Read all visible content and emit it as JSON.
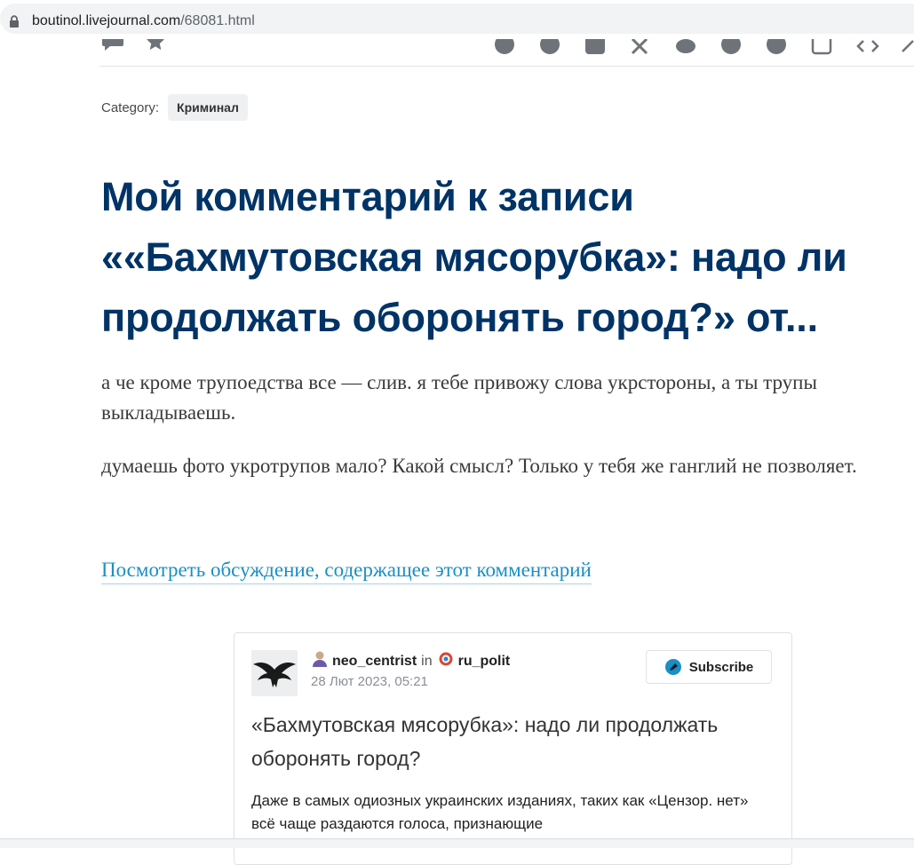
{
  "browser": {
    "url_host": "boutinol.livejournal.com",
    "url_path": "/68081.html"
  },
  "toolbar": {
    "left_icons": [
      "comment-icon",
      "bookmark-icon"
    ],
    "share_icons": [
      "vk-icon",
      "facebook-icon",
      "ok-icon",
      "x-icon",
      "twitter-icon",
      "whatsapp-icon",
      "telegram-icon",
      "repost-icon",
      "embed-icon",
      "link-icon"
    ]
  },
  "post": {
    "category_label": "Category:",
    "category": "Криминал",
    "title": "Мой комментарий к записи ««Бахмутовская мясорубка»: надо ли продолжать оборонять город?» от...",
    "paragraphs": [
      "а че кроме трупоедства все — слив. я тебе привожу слова укрстороны, а ты трупы выкладываешь.",
      "думаешь фото укротрупов мало? Какой смысл? Только у тебя же ганглий не позволяет."
    ],
    "discussion_link": "Посмотреть обсуждение, содержащее этот комментарий"
  },
  "embed": {
    "author": "neo_centrist",
    "in_word": "in",
    "community": "ru_polit",
    "date": "28 Лют 2023, 05:21",
    "subscribe_label": "Subscribe",
    "title": "«Бахмутовская мясорубка»: надо ли продолжать оборонять город?",
    "excerpt": "Даже в самых одиозных украинских изданиях, таких как «Цензор. нет» всё чаще раздаются голоса, признающие"
  },
  "colors": {
    "title": "#003366",
    "link": "#1a8fc4",
    "icon_gray": "#6e7379"
  }
}
